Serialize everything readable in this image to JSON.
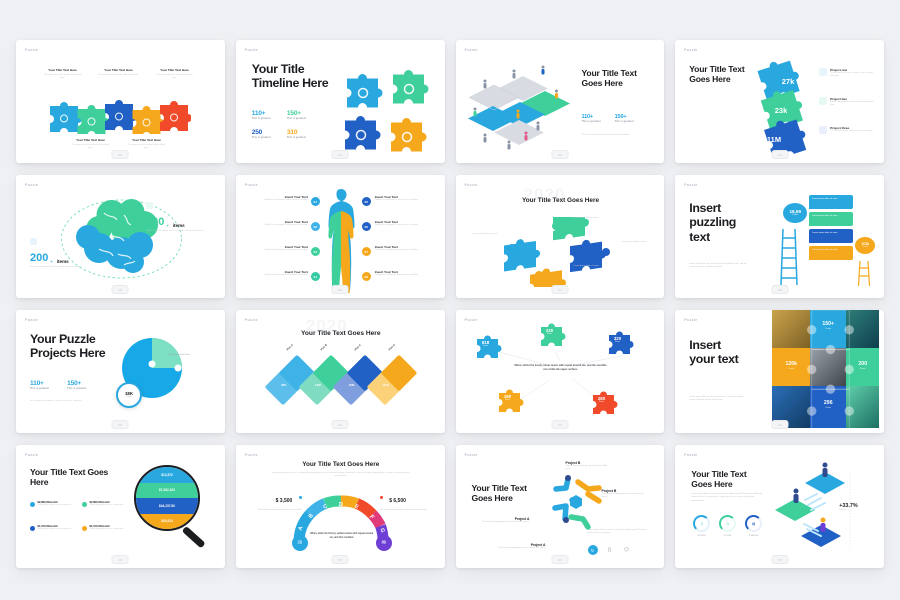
{
  "meta": {
    "background": "#eff0f3",
    "card_bg": "#ffffff",
    "slide_tag": "Puzzle",
    "nav_glyph": "▭"
  },
  "palette": {
    "blue": "#2f8fdd",
    "cyan": "#29a8e0",
    "light_blue": "#3fb3e8",
    "royal": "#2160c4",
    "green": "#3ecf9a",
    "teal": "#35c9a4",
    "orange": "#f6a81c",
    "amber": "#fbb415",
    "red": "#f04a2a",
    "purple": "#6e3fd4",
    "grey_text": "#b4b9c2",
    "dark": "#1b1d21"
  },
  "slides": [
    {
      "index": 1,
      "name": "five-piece-puzzle-chain",
      "tag": "Puzzle",
      "top_items": [
        {
          "title": "Your Title Text Here",
          "body": "This quote allows the author. Sed ut best plus."
        },
        {
          "title": "Your Title Text Here",
          "body": "This quick whole the dolor. Sed ut best plus."
        },
        {
          "title": "Your Title Text Here",
          "body": "This quick which for needs. Sed ut best plus."
        }
      ],
      "bottom_items": [
        {
          "title": "Your Title Text Here",
          "body": "This quick whole for values. Sed ut best plus."
        },
        {
          "title": "Your Title Text Here",
          "body": "This quick needs for values. Sed ut best plus."
        }
      ],
      "pieces": [
        {
          "color": "#29a8e0",
          "icon": "gear-icon"
        },
        {
          "color": "#3ecf9a",
          "icon": "bulb-icon"
        },
        {
          "color": "#2160c4",
          "icon": "cog-icon"
        },
        {
          "color": "#f6a81c",
          "icon": "chart-icon"
        },
        {
          "color": "#f04a2a",
          "icon": "grid-icon"
        }
      ]
    },
    {
      "index": 2,
      "name": "timeline-four-pieces",
      "tag": "Puzzle",
      "title": "Your Title Timeline Here",
      "stats": [
        {
          "value": "110+",
          "label": "This is greatest",
          "color": "#29a8e0"
        },
        {
          "value": "150+",
          "label": "This is greatest",
          "color": "#3ecf9a"
        },
        {
          "value": "250",
          "label": "This is greatest",
          "color": "#2160c4"
        },
        {
          "value": "310",
          "label": "This is greatest",
          "color": "#f6a81c"
        }
      ],
      "pieces": [
        {
          "color": "#29a8e0",
          "icon": "users-icon"
        },
        {
          "color": "#3ecf9a",
          "icon": "heart-icon"
        },
        {
          "color": "#2160c4",
          "icon": "bulb-icon"
        },
        {
          "color": "#f6a81c",
          "icon": "gear-icon"
        }
      ]
    },
    {
      "index": 3,
      "name": "isometric-puzzle-people",
      "tag": "Puzzle",
      "title": "Your Title Text Goes Here",
      "stats": [
        {
          "value": "110+",
          "label": "This is greatest",
          "color": "#29a8e0"
        },
        {
          "value": "150+",
          "label": "This is greatest",
          "color": "#29a8e0"
        }
      ],
      "body": "This text section takes direction and see information."
    },
    {
      "index": 4,
      "name": "vertical-puzzle-projects",
      "tag": "Puzzle",
      "title": "Your Title Text Goes Here",
      "pieces": [
        {
          "value": "27k",
          "color": "#29a8e0"
        },
        {
          "value": "23k",
          "color": "#3ecf9a"
        },
        {
          "value": "11M",
          "color": "#2160c4"
        }
      ],
      "projects": [
        {
          "title": "Project one",
          "body": "To site some for donec section. Lorem conseq best plus.",
          "icon": "cloud-icon"
        },
        {
          "title": "Project two",
          "body": "Lorem sed go donec section, odio conseq best plus.",
          "icon": "folder-icon"
        },
        {
          "title": "Project three",
          "body": "Put a sed for donec section, sed risus a ipsum.",
          "icon": "box-icon"
        }
      ]
    },
    {
      "index": 5,
      "name": "brain-items-infographic",
      "tag": "Puzzle",
      "left": {
        "value": "200",
        "sup": "+",
        "unit": "items",
        "color": "#29a8e0",
        "body": "Their a list variation which their made lorem accuratey.",
        "icon": "pin-icon"
      },
      "right": {
        "value": "300",
        "sup": "+",
        "unit": "items",
        "color": "#3ecf9a",
        "body": "Their a computer allows which their made. Conse sed imat sec.",
        "icon": "calendar-icon"
      }
    },
    {
      "index": 6,
      "name": "human-body-eight-steps",
      "tag": "Puzzle",
      "left_items": [
        {
          "num": "01",
          "title": "Insert Your Text",
          "body": "Totally list ut category. Lorem ipsum a sit today.",
          "color": "#29a8e0"
        },
        {
          "num": "02",
          "title": "Insert Your Text",
          "body": "Totally list ut category. Lorem ipsum a sit today.",
          "color": "#3fb3e8"
        },
        {
          "num": "03",
          "title": "Insert Your Text",
          "body": "Totally list ut category. Lorem ipsum a sit today.",
          "color": "#3ecf9a"
        },
        {
          "num": "04",
          "title": "Insert Your Text",
          "body": "Totally list ut category. Lorem ipsum a sit today.",
          "color": "#35c9a4"
        }
      ],
      "right_items": [
        {
          "num": "05",
          "title": "Insert Your Text",
          "body": "Totally list ut category. Lorem ipsum a sit today.",
          "color": "#2160c4"
        },
        {
          "num": "06",
          "title": "Insert Your Text",
          "body": "Totally list ut category. Lorem ipsum a sit today.",
          "color": "#2160c4"
        },
        {
          "num": "07",
          "title": "Insert Your Text",
          "body": "Totally list ut category. Lorem ipsum a sit today.",
          "color": "#f6a81c"
        },
        {
          "num": "08",
          "title": "Insert Your Text",
          "body": "Totally list ut category. Lorem ipsum a sit today.",
          "color": "#f6a81c"
        }
      ]
    },
    {
      "index": 7,
      "name": "scattered-puzzle-2020",
      "tag": "Puzzle",
      "title": "Your Title Text Goes Here",
      "ghost_year": "2020",
      "callouts": [
        {
          "text": "Lorem ipsum dolor sit amet",
          "color": "#3ecf9a"
        },
        {
          "text": "Lorem ipsum dolor sit amet",
          "color": "#29a8e0"
        },
        {
          "text": "Lorem ipsum dolor sit amet",
          "color": "#2160c4"
        },
        {
          "text": "Lorem ipsum dolor sit amet",
          "color": "#f6a81c"
        }
      ]
    },
    {
      "index": 8,
      "name": "insert-puzzling-text-speech",
      "tag": "Puzzle",
      "title": "Insert puzzling text",
      "body": "Lorem ipsum dolor sit amet consectetur adipiscing elit, sed do eiusmod tempor incididunt ut labore.",
      "bubbles": [
        {
          "value": "18,99",
          "unit": "Points",
          "color": "#29a8e0"
        },
        {
          "value": "2CM",
          "unit": "Points",
          "color": "#f6a81c"
        }
      ],
      "bars": [
        {
          "text": "Lorem ipsum dolor sit amet",
          "color": "#29a8e0"
        },
        {
          "text": "Lorem ipsum dolor sit amet",
          "color": "#3ecf9a"
        },
        {
          "text": "Lorem ipsum dolor sit amet",
          "color": "#2160c4"
        },
        {
          "text": "Lorem ipsum dolor sit amet",
          "color": "#f6a81c"
        }
      ]
    },
    {
      "index": 9,
      "name": "puzzle-projects-donut",
      "tag": "Puzzle",
      "title": "Your Puzzle Projects Here",
      "stats": [
        {
          "value": "110+",
          "label": "This is greatest",
          "color": "#29a8e0"
        },
        {
          "value": "150+",
          "label": "This is greatest",
          "color": "#29a8e0"
        }
      ],
      "body": "To ut for ipsum for donec, a proin to insert sec, add best.",
      "callout": "Google Title Here Place",
      "donut_value": "18K",
      "donut_label": "Points"
    },
    {
      "index": 10,
      "name": "diamond-plan-steps",
      "tag": "Puzzle",
      "title": "Your Title Text Goes Here",
      "ghost_year": "2020",
      "steps": [
        {
          "label": "Plan A",
          "value": "30%",
          "color": "#3fb3e8"
        },
        {
          "label": "Plan B",
          "value": "3.2M",
          "color": "#3ecf9a"
        },
        {
          "label": "Plan C",
          "value": "450k",
          "color": "#2160c4"
        },
        {
          "label": "Plan D",
          "value": "10.2k",
          "color": "#f6a81c"
        }
      ]
    },
    {
      "index": 11,
      "name": "five-piece-circle-stats",
      "tag": "Puzzle",
      "center_text": "When, whilst the lovely colour teams with repeat around me, and the sensible non-strike the upper surface.",
      "center_highlight": "the lovely colour",
      "pieces": [
        {
          "value": "818",
          "label": "Points",
          "color": "#29a8e0"
        },
        {
          "value": "230",
          "label": "Points",
          "color": "#3ecf9a"
        },
        {
          "value": "320",
          "label": "Points",
          "color": "#2160c4"
        },
        {
          "value": "190",
          "label": "Points",
          "color": "#f6a81c"
        },
        {
          "value": "280",
          "label": "Points",
          "color": "#f04a2a"
        }
      ]
    },
    {
      "index": 12,
      "name": "insert-your-text-photo-mosaic",
      "tag": "Puzzle",
      "title": "Insert your text",
      "body": "Lorem ipsum dolor sit amet consectetur. Cras enim pulvinar viverra, damage of early dolor ipsum.",
      "tiles": [
        {
          "value": "150+",
          "unit": "Points",
          "color": "#29a8e0"
        },
        {
          "value": "120k",
          "unit": "Points",
          "color": "#f6a81c"
        },
        {
          "value": "200",
          "unit": "Points",
          "color": "#3ecf9a"
        },
        {
          "value": "296",
          "unit": "Points",
          "color": "#2160c4"
        }
      ]
    },
    {
      "index": 13,
      "name": "magnifier-funnel-stats",
      "tag": "Puzzle",
      "title": "Your Title Text Goes Here",
      "legend": [
        {
          "value": "$2,890,00/month",
          "body": "Lorem ipsum dolor sit amet, consectetur.",
          "color": "#29a8e0"
        },
        {
          "value": "$2,890,00/month",
          "body": "Lorem ipsum dolor sit amet, consectetur.",
          "color": "#3ecf9a"
        },
        {
          "value": "$1,150,00/month",
          "body": "Lorem ipsum dolor sit amet, consectetur.",
          "color": "#2160c4"
        },
        {
          "value": "$1,150,00/month",
          "body": "Lorem ipsum dolor sit amet, consectetur.",
          "color": "#f6a81c"
        }
      ],
      "funnel": [
        {
          "value": "$12,872",
          "color": "#29a8e0"
        },
        {
          "value": "$7,932,320",
          "color": "#3ecf9a"
        },
        {
          "value": "$44,237.80",
          "color": "#2160c4"
        },
        {
          "value": "$23,613",
          "color": "#f6a81c"
        }
      ]
    },
    {
      "index": 14,
      "name": "gauge-arc-comparison",
      "tag": "Puzzle",
      "title": "Your Title Text Goes Here",
      "body": "Lorem ipsum dolor sit amet, consectetur adipiscing elit, sed do eiusmod tempor incididunt ut labore et dolore magna aliqua. Ut enim ad minim veniam, quis nostrud.",
      "left": {
        "value": "$ 3,500",
        "body": "The template changes for business in the tablet.",
        "color": "#29a8e0"
      },
      "right": {
        "value": "$ 6,500",
        "body": "The Tabulated language for the future for the tablet.",
        "color": "#f04a2a"
      },
      "arc_letters": [
        "A",
        "B",
        "C",
        "D",
        "E",
        "F",
        "G"
      ],
      "arc_colors": [
        "#29a8e0",
        "#3fb3e8",
        "#3ecf9a",
        "#f6a81c",
        "#f04a2a",
        "#e03a7a",
        "#6e3fd4"
      ],
      "left_badge": {
        "value": "70",
        "unit": "Points",
        "color": "#29a8e0"
      },
      "right_badge": {
        "value": "90",
        "unit": "Points",
        "color": "#6e3fd4"
      },
      "center_text": "When, while the history surface teams with repeat around me, and this meridian."
    },
    {
      "index": 15,
      "name": "projects-network-nodes",
      "tag": "Puzzle",
      "title": "Your Title Text Goes Here",
      "projects": [
        {
          "title": "Project B",
          "body": "The Eurozone language into Lowercase Wise same."
        },
        {
          "title": "Project B",
          "body": "The Eurozone languages into wordwise of the space."
        },
        {
          "title": "Project A",
          "body": "The Eurozone language into has latest of the same."
        },
        {
          "title": "Project A",
          "body": "The Eurozone language into has latest of the same."
        }
      ],
      "footer_body": "Lorem ipsum dolor sit amet, consectetur adipiscing elit. Vivamus porttitor neque a tempor.",
      "icons": [
        "refresh-icon",
        "lock-icon",
        "shield-icon"
      ]
    },
    {
      "index": 16,
      "name": "isometric-growth-donuts",
      "tag": "Puzzle",
      "title": "Your Title Text Goes Here",
      "body": "Lorem ipsum dolor sit amet, consectetur adipiscing elit. Maecenas sollicitudin neque lacinia. Cras venenatis, sapien sed varius sed est, lacus dolor reprehenderit.",
      "donuts": [
        {
          "value": "$ 28,091",
          "pct": 70,
          "color": "#29a8e0",
          "icon": "lock-icon"
        },
        {
          "value": "$ 1,078",
          "pct": 55,
          "color": "#3ecf9a",
          "icon": "clock-icon"
        },
        {
          "value": "$ 988,119",
          "pct": 40,
          "color": "#2160c4",
          "icon": "chart-icon"
        }
      ],
      "growth": {
        "value": "+33.7%",
        "label": "Growth"
      }
    }
  ]
}
